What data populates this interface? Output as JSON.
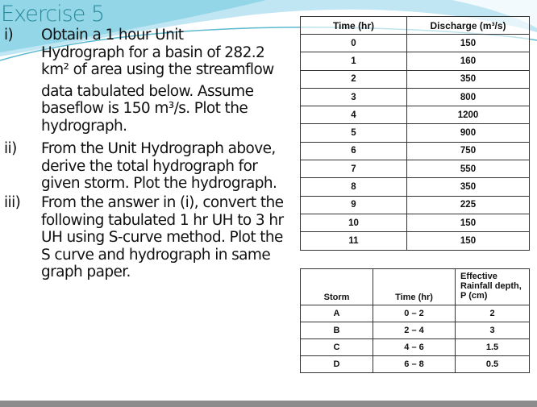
{
  "title": "Exercise 5",
  "questions": [
    {
      "num": "i)",
      "lines": [
        "Obtain a 1 hour Unit",
        "Hydrograph for a basin of 282.2",
        "km² of area using the streamflow",
        "data tabulated below. Assume",
        "baseflow is 150 m³/s. Plot the",
        "hydrograph."
      ]
    },
    {
      "num": "ii)",
      "lines": [
        "From the Unit Hydrograph above,",
        "derive the total hydrograph for",
        "given storm. Plot the hydrograph."
      ]
    },
    {
      "num": "iii)",
      "lines": [
        "From the answer in (i), convert the",
        "following tabulated 1 hr UH to 3 hr",
        "UH using S-curve method. Plot the",
        "S curve and hydrograph in same",
        "graph paper."
      ]
    }
  ],
  "streamflow_table": {
    "headers": [
      "Time (hr)",
      "Discharge (m³/s)"
    ],
    "rows": [
      [
        "0",
        "150"
      ],
      [
        "1",
        "160"
      ],
      [
        "2",
        "350"
      ],
      [
        "3",
        "800"
      ],
      [
        "4",
        "1200"
      ],
      [
        "5",
        "900"
      ],
      [
        "6",
        "750"
      ],
      [
        "7",
        "550"
      ],
      [
        "8",
        "350"
      ],
      [
        "9",
        "225"
      ],
      [
        "10",
        "150"
      ],
      [
        "11",
        "150"
      ]
    ]
  },
  "storm_table": {
    "headers": [
      "Storm",
      "Time (hr)",
      "Effective Rainfall depth, P (cm)"
    ],
    "rows": [
      [
        "A",
        "0 – 2",
        "2"
      ],
      [
        "B",
        "2 – 4",
        "3"
      ],
      [
        "C",
        "4 – 6",
        "1.5"
      ],
      [
        "D",
        "6 – 8",
        "0.5"
      ]
    ]
  }
}
